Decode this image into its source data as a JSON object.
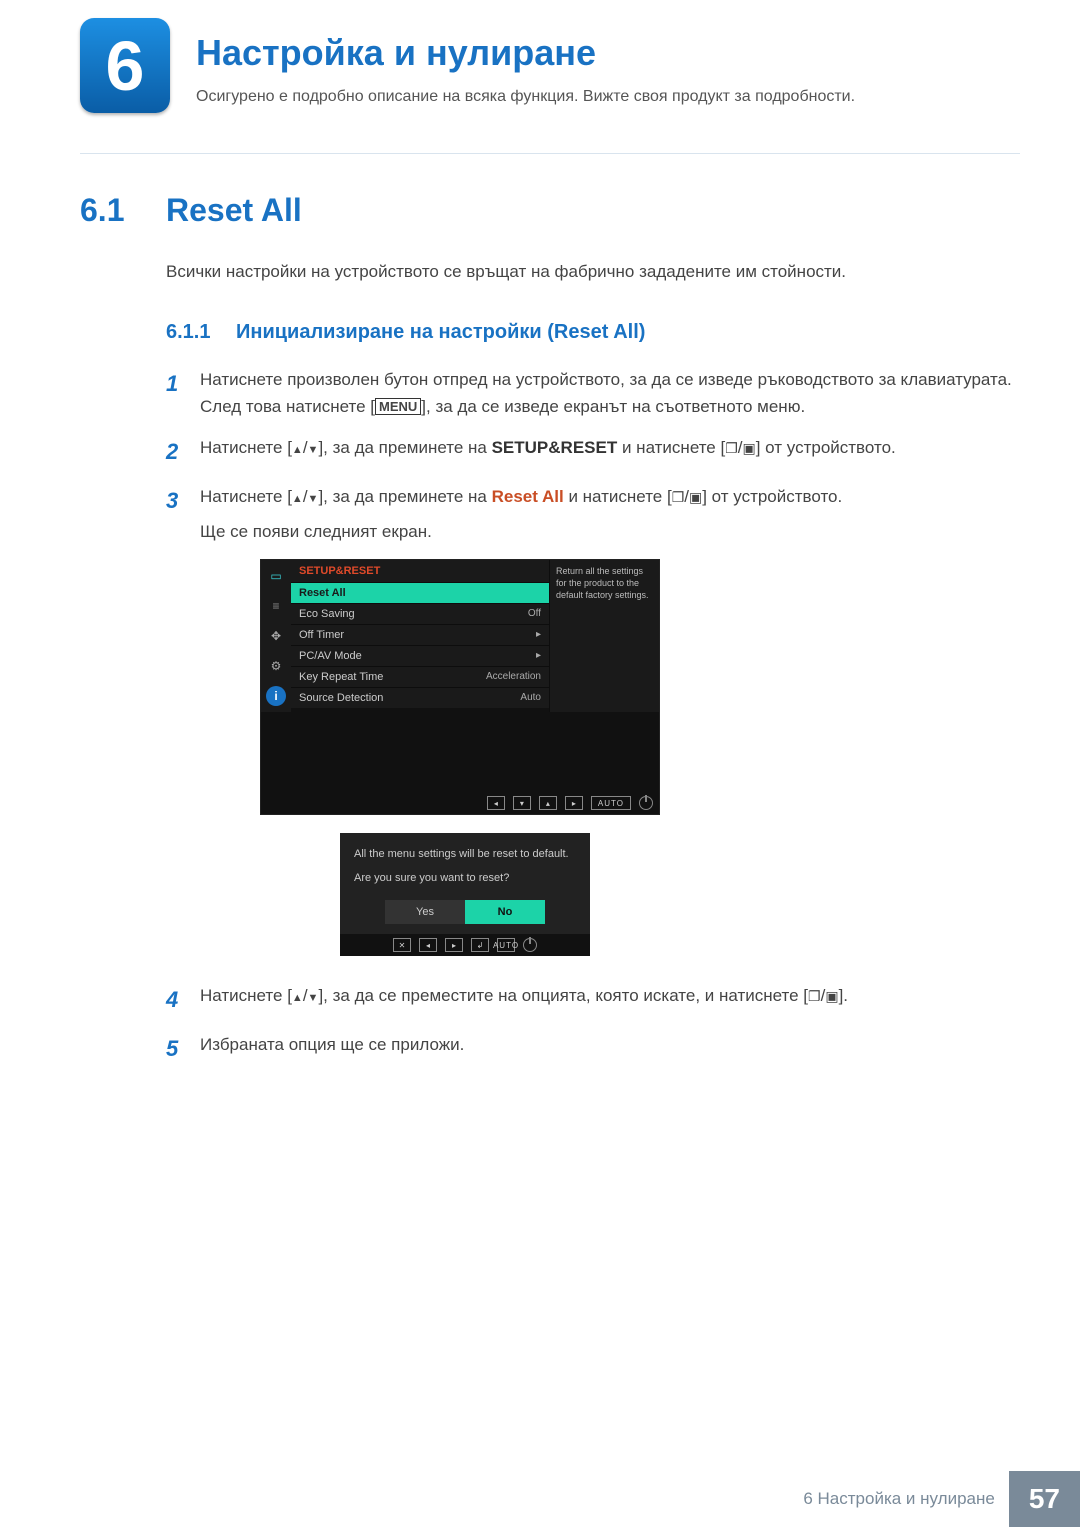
{
  "chapter": {
    "number": "6",
    "title": "Настройка и нулиране",
    "subtitle": "Осигурено е подробно описание на всяка функция. Вижте своя продукт за подробности."
  },
  "section": {
    "number": "6.1",
    "title": "Reset All",
    "intro": "Всички настройки на устройството се връщат на фабрично зададените им стойности."
  },
  "subsection": {
    "number": "6.1.1",
    "title": "Инициализиране на настройки (Reset All)"
  },
  "steps": {
    "s1_a": "Натиснете произволен бутон отпред на устройството, за да се изведе ръководството за клавиатурата. След това натиснете [",
    "s1_menu": "MENU",
    "s1_b": "], за да се изведе екранът на съответното меню.",
    "s2_a": "Натиснете [",
    "s2_b": "], за да преминете на ",
    "s2_setup": "SETUP&RESET",
    "s2_c": " и натиснете [",
    "s2_d": "] от устройството.",
    "s3_a": "Натиснете [",
    "s3_b": "], за да преминете на ",
    "s3_reset": "Reset All",
    "s3_c": " и натиснете [",
    "s3_d": "] от устройството.",
    "s3_follow": "Ще се появи следният екран.",
    "s4_a": "Натиснете [",
    "s4_b": "], за да се преместите на опцията, която искате, и натиснете [",
    "s4_c": "].",
    "s5": "Избраната опция ще се приложи."
  },
  "step_nums": {
    "n1": "1",
    "n2": "2",
    "n3": "3",
    "n4": "4",
    "n5": "5"
  },
  "osd1": {
    "title": "SETUP&RESET",
    "rows": [
      {
        "label": "Reset All",
        "value": "",
        "sel": true
      },
      {
        "label": "Eco Saving",
        "value": "Off"
      },
      {
        "label": "Off Timer",
        "value": "▸"
      },
      {
        "label": "PC/AV Mode",
        "value": "▸"
      },
      {
        "label": "Key Repeat Time",
        "value": "Acceleration"
      },
      {
        "label": "Source Detection",
        "value": "Auto"
      }
    ],
    "desc": "Return all the settings for the product to the default factory settings.",
    "nav": {
      "left": "◂",
      "down": "▾",
      "up": "▴",
      "right": "▸",
      "auto": "AUTO"
    }
  },
  "osd2": {
    "line1": "All the menu settings will be reset to default.",
    "line2": "Are you sure you want to reset?",
    "yes": "Yes",
    "no": "No",
    "nav": {
      "left": "◂",
      "right": "▸",
      "enter": "↲",
      "auto": "AUTO"
    }
  },
  "footer": {
    "text": "6 Настройка и нулиране",
    "page": "57"
  }
}
